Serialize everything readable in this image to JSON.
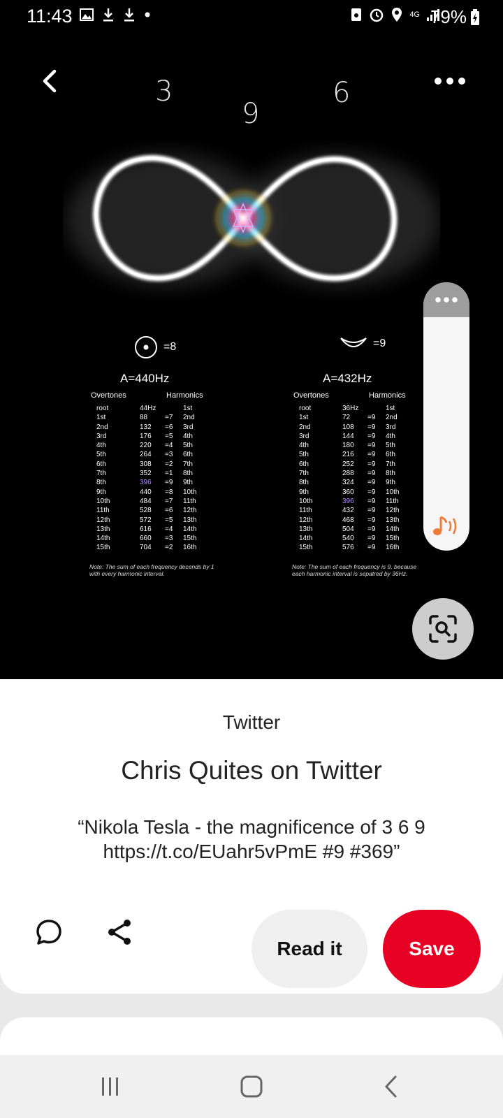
{
  "status_bar": {
    "time": "11:43",
    "battery": "79%",
    "network": "4G"
  },
  "image": {
    "numbers": [
      "3",
      "9",
      "6"
    ],
    "left_table": {
      "symbol_value": "=8",
      "frequency": "A=440Hz",
      "overtones_label": "Overtones",
      "harmonics_label": "Harmonics",
      "rows": [
        [
          "root",
          "44Hz",
          "",
          "1st"
        ],
        [
          "1st",
          "88",
          "=7",
          "2nd"
        ],
        [
          "2nd",
          "132",
          "=6",
          "3rd"
        ],
        [
          "3rd",
          "176",
          "=5",
          "4th"
        ],
        [
          "4th",
          "220",
          "=4",
          "5th"
        ],
        [
          "5th",
          "264",
          "=3",
          "6th"
        ],
        [
          "6th",
          "308",
          "=2",
          "7th"
        ],
        [
          "7th",
          "352",
          "=1",
          "8th"
        ],
        [
          "8th",
          "396",
          "=9",
          "9th"
        ],
        [
          "9th",
          "440",
          "=8",
          "10th"
        ],
        [
          "10th",
          "484",
          "=7",
          "11th"
        ],
        [
          "11th",
          "528",
          "=6",
          "12th"
        ],
        [
          "12th",
          "572",
          "=5",
          "13th"
        ],
        [
          "13th",
          "616",
          "=4",
          "14th"
        ],
        [
          "14th",
          "660",
          "=3",
          "15th"
        ],
        [
          "15th",
          "704",
          "=2",
          "16th"
        ]
      ],
      "note": "Note: The sum of each frequency decends by 1 with every harmonic interval."
    },
    "right_table": {
      "symbol_value": "=9",
      "frequency": "A=432Hz",
      "overtones_label": "Overtones",
      "harmonics_label": "Harmonics",
      "rows": [
        [
          "root",
          "36Hz",
          "",
          "1st"
        ],
        [
          "1st",
          "72",
          "=9",
          "2nd"
        ],
        [
          "2nd",
          "108",
          "=9",
          "3rd"
        ],
        [
          "3rd",
          "144",
          "=9",
          "4th"
        ],
        [
          "4th",
          "180",
          "=9",
          "5th"
        ],
        [
          "5th",
          "216",
          "=9",
          "6th"
        ],
        [
          "6th",
          "252",
          "=9",
          "7th"
        ],
        [
          "7th",
          "288",
          "=9",
          "8th"
        ],
        [
          "8th",
          "324",
          "=9",
          "9th"
        ],
        [
          "9th",
          "360",
          "=9",
          "10th"
        ],
        [
          "10th",
          "396",
          "=9",
          "11th"
        ],
        [
          "11th",
          "432",
          "=9",
          "12th"
        ],
        [
          "12th",
          "468",
          "=9",
          "13th"
        ],
        [
          "13th",
          "504",
          "=9",
          "14th"
        ],
        [
          "14th",
          "540",
          "=9",
          "15th"
        ],
        [
          "15th",
          "576",
          "=9",
          "16th"
        ]
      ],
      "note": "Note: The sum of each frequency is 9, because each harmonic interval is sepatred by 36Hz."
    }
  },
  "pin": {
    "source": "Twitter",
    "title": "Chris Quites on Twitter",
    "description": "“Nikola Tesla - the magnificence of 3 6 9 https://t.co/EUahr5vPmE #9 #369”",
    "read_label": "Read it",
    "save_label": "Save"
  },
  "colors": {
    "save": "#e60023",
    "highlight": "#b38cff",
    "sound_icon": "#f07a3a"
  },
  "icons": [
    "back-icon",
    "more-icon",
    "lens-search-icon",
    "comment-icon",
    "share-icon",
    "sound-icon"
  ]
}
